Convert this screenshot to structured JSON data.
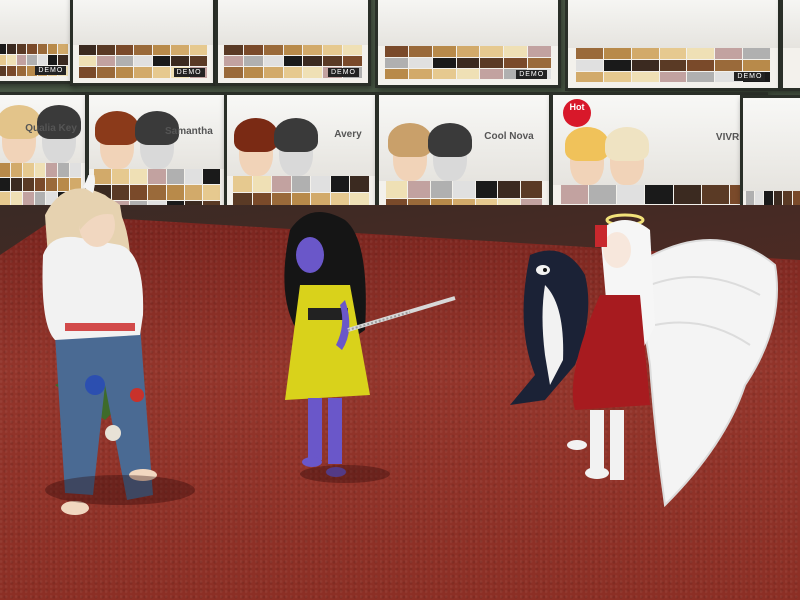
{
  "scene": {
    "posters_top_row": [
      {
        "name": "",
        "hair": "#5b3a22"
      },
      {
        "name": "",
        "hair": "#caa77a"
      },
      {
        "name": "",
        "hair": "#3d2a20"
      },
      {
        "name": "",
        "hair": "#e7c98f"
      },
      {
        "name": "",
        "hair": "#e9d39a"
      }
    ],
    "posters_bottom_row": [
      {
        "name": "Qualia Key",
        "hair": "#e3c48a"
      },
      {
        "name": "Samantha",
        "hair": "#8b3a1a"
      },
      {
        "name": "Avery",
        "hair": "#7a2a14"
      },
      {
        "name": "Cool Nova",
        "hair": "#c9a06a"
      },
      {
        "name": "VIVRE",
        "hair": "#f0c25a",
        "badge": "Hot"
      }
    ],
    "demo_label": "DEMO",
    "colors": {
      "wall": "#4a5a47",
      "carpet": "#8c2f25",
      "poster_frame": "#2a2f28",
      "hot_badge": "#d8182a"
    },
    "avatars": [
      {
        "id": "blonde-horned-avatar",
        "shirt": "#f2f2f2",
        "jeans": "#4a6a93",
        "hair": "#e6d2b0"
      },
      {
        "id": "purple-avatar-yellow-dress",
        "dress": "#d9d21b",
        "skin": "#6a57c9",
        "hair": "#151515"
      },
      {
        "id": "orca-plush-avatar",
        "body": "#1b2236",
        "belly": "#f2f2f2"
      },
      {
        "id": "angel-winged-avatar",
        "dress": "#a71b1f",
        "wings": "#f4f4f4",
        "hair": "#f6f6f6",
        "halo": "#f2e27a"
      }
    ]
  }
}
